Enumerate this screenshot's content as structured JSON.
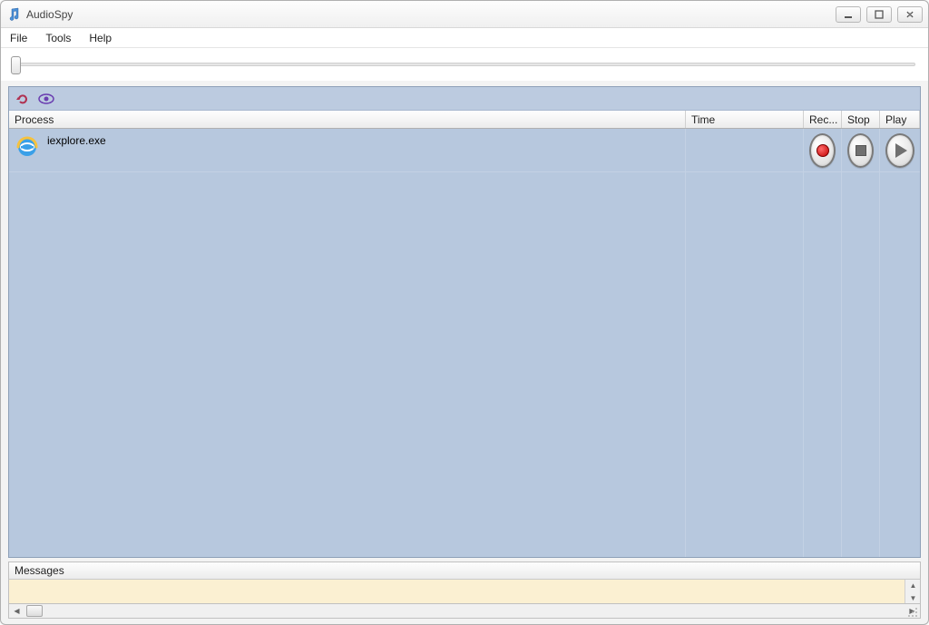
{
  "window": {
    "title": "AudioSpy",
    "icon": "music-note-icon"
  },
  "menu": {
    "file": "File",
    "tools": "Tools",
    "help": "Help"
  },
  "toolbar": {
    "refresh_icon": "refresh-icon",
    "eye_icon": "eye-icon"
  },
  "columns": {
    "process": "Process",
    "time": "Time",
    "record": "Rec...",
    "stop": "Stop",
    "play": "Play"
  },
  "rows": [
    {
      "process_name": "iexplore.exe",
      "time": "",
      "icon": "internet-explorer-icon"
    }
  ],
  "messages": {
    "header": "Messages"
  }
}
